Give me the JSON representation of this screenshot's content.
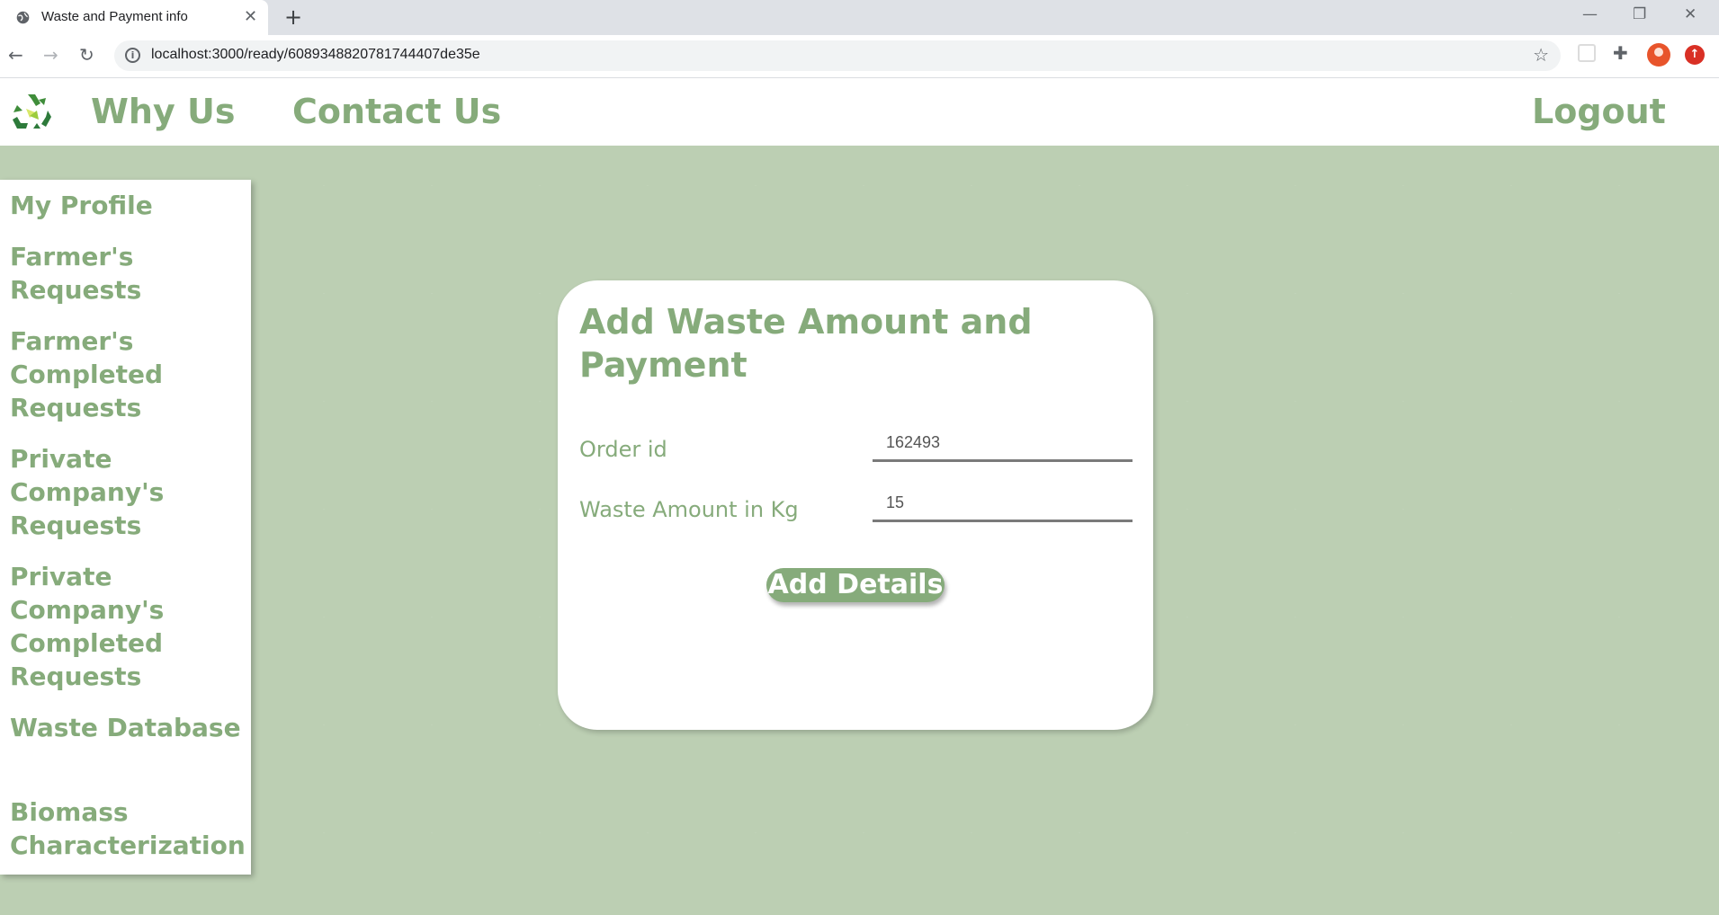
{
  "browser": {
    "tab_title": "Waste and Payment info",
    "url": "localhost:3000/ready/6089348820781744407de35e"
  },
  "navbar": {
    "logo_icon": "recycle-icon",
    "links": [
      "Why Us",
      "Contact Us"
    ],
    "logout": "Logout"
  },
  "sidebar": {
    "items": [
      "My Profile",
      "Farmer's Requests",
      "Farmer's Completed Requests",
      "Private Company's Requests",
      "Private Company's Completed Requests",
      "Waste Database",
      "Biomass Characterization"
    ]
  },
  "form": {
    "title": "Add Waste Amount and Payment",
    "fields": [
      {
        "label": "Order id",
        "value": "162493"
      },
      {
        "label": "Waste Amount in Kg",
        "value": "15"
      }
    ],
    "submit_label": "Add Details"
  },
  "colors": {
    "accent": "#86ab7b",
    "background": "#bccfb3"
  }
}
